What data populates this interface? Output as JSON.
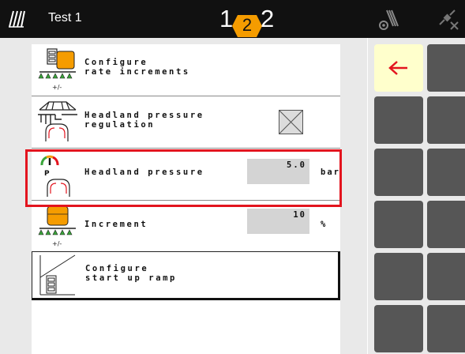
{
  "topbar": {
    "title": "Test 1",
    "page_left": "1",
    "page_marker": "2",
    "page_right": "2",
    "icons": [
      "tramlines-icon",
      "sprayer-gear-icon",
      "gps-off-icon"
    ]
  },
  "rows": [
    {
      "label": "Configure\nrate increments",
      "icon": "sprayer-rate-icon"
    },
    {
      "label": "Headland pressure\nregulation",
      "icon": "boom-headland-icon"
    },
    {
      "label": "Headland pressure",
      "value": "5.0",
      "unit": "bar",
      "icon": "pressure-gauge-headland-icon"
    },
    {
      "label": "Increment",
      "value": "10",
      "unit": "%",
      "icon": "sprayer-increment-icon"
    },
    {
      "label": "Configure\nstart up ramp",
      "icon": "ramp-chart-icon"
    }
  ],
  "sidebar": {
    "back_icon": "arrow-left-icon",
    "accent_color": "#e3141e",
    "button_color": "#565656",
    "back_bg": "#ffffcc"
  }
}
